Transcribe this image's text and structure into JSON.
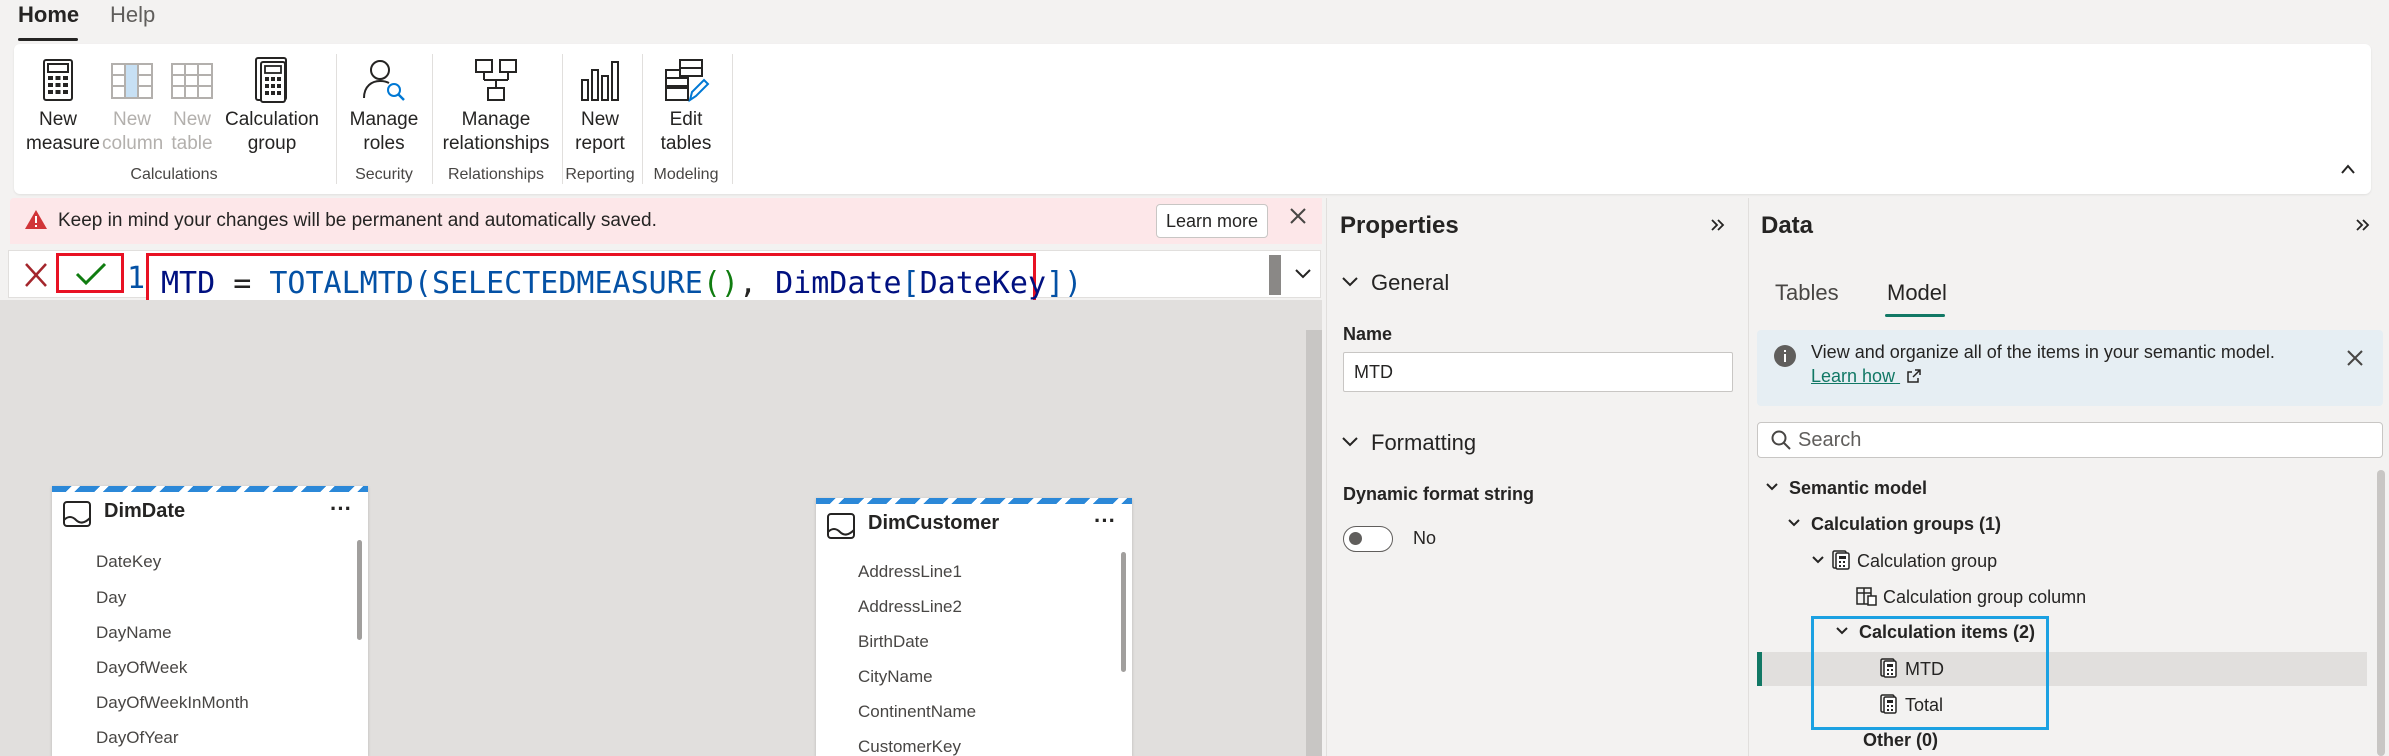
{
  "tabs": {
    "home": "Home",
    "help": "Help"
  },
  "ribbon": {
    "new_measure": "New measure",
    "new_measure_l1": "New",
    "new_measure_l2": "measure",
    "new_column_l1": "New",
    "new_column_l2": "column",
    "new_table_l1": "New",
    "new_table_l2": "table",
    "calc_group_l1": "Calculation",
    "calc_group_l2": "group",
    "calculations_label": "Calculations",
    "manage_roles_l1": "Manage",
    "manage_roles_l2": "roles",
    "security_label": "Security",
    "manage_rel_l1": "Manage",
    "manage_rel_l2": "relationships",
    "relationships_label": "Relationships",
    "new_report_l1": "New",
    "new_report_l2": "report",
    "reporting_label": "Reporting",
    "edit_tables_l1": "Edit",
    "edit_tables_l2": "tables",
    "modeling_label": "Modeling"
  },
  "warning": {
    "text": "Keep in mind your changes will be permanent and automatically saved.",
    "learn_more": "Learn more"
  },
  "formula": {
    "line_number": "1",
    "name": "MTD",
    "op": " = ",
    "fn": "TOTALMTD",
    "open": "(",
    "inner_fn": "SELECTEDMEASURE",
    "inner_parens": "()",
    "comma": ", ",
    "table": "DimDate",
    "col_open": "[",
    "col": "DateKey",
    "col_close": "]",
    "close": ")"
  },
  "canvas": {
    "dimdate": {
      "title": "DimDate",
      "fields": [
        "DateKey",
        "Day",
        "DayName",
        "DayOfWeek",
        "DayOfWeekInMonth",
        "DayOfYear"
      ]
    },
    "dimcustomer": {
      "title": "DimCustomer",
      "fields": [
        "AddressLine1",
        "AddressLine2",
        "BirthDate",
        "CityName",
        "ContinentName",
        "CustomerKey"
      ]
    },
    "more_glyph": "···"
  },
  "properties": {
    "title": "Properties",
    "general": "General",
    "name_label": "Name",
    "name_value": "MTD",
    "formatting": "Formatting",
    "dynamic_format_label": "Dynamic format string",
    "dynamic_format_value": "No"
  },
  "data_pane": {
    "title": "Data",
    "tab_tables": "Tables",
    "tab_model": "Model",
    "info_text": "View and organize all of the items in your semantic model.",
    "info_link": "Learn how",
    "search_placeholder": "Search",
    "tree": {
      "semantic_model": "Semantic model",
      "calculation_groups": "Calculation groups (1)",
      "calculation_group": "Calculation group",
      "calculation_group_column": "Calculation group column",
      "calculation_items": "Calculation items (2)",
      "item_mtd": "MTD",
      "item_total": "Total",
      "other": "Other (0)"
    }
  },
  "colors": {
    "accent": "#117865",
    "highlight_red": "#e81123",
    "highlight_blue": "#1ba1e2",
    "warning_bg": "#fde7e9"
  }
}
